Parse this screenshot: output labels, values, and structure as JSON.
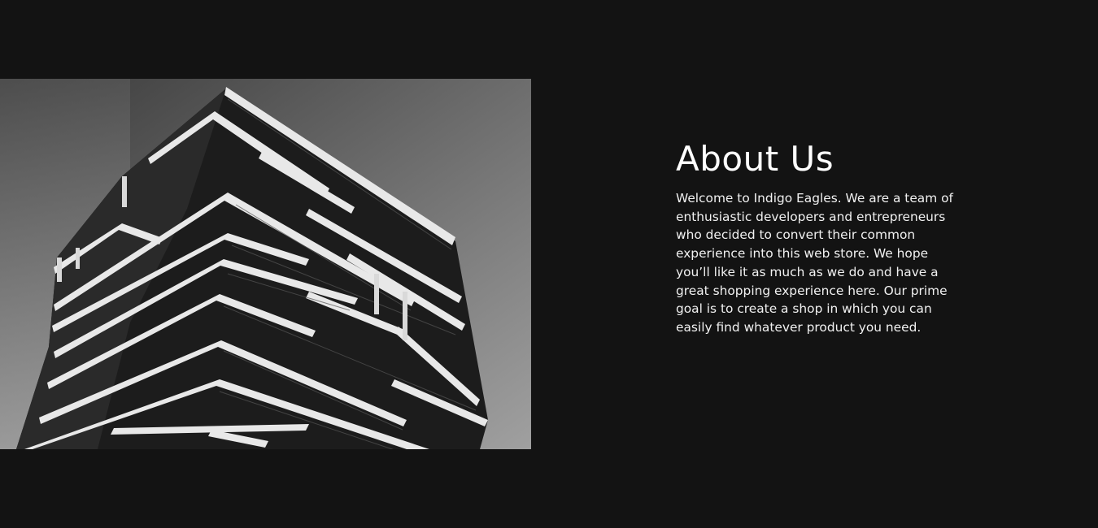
{
  "about": {
    "title": "About Us",
    "body": "Welcome to Indigo Eagles. We are a team of enthusiastic developers and entrepreneurs who decided to convert their common experience into this web store. We hope you’ll like it as much as we do and have a great shopping experience here. Our prime goal is to create a shop in which you can easily find whatever product you need."
  },
  "colors": {
    "background": "#131313",
    "text": "#ffffff"
  }
}
